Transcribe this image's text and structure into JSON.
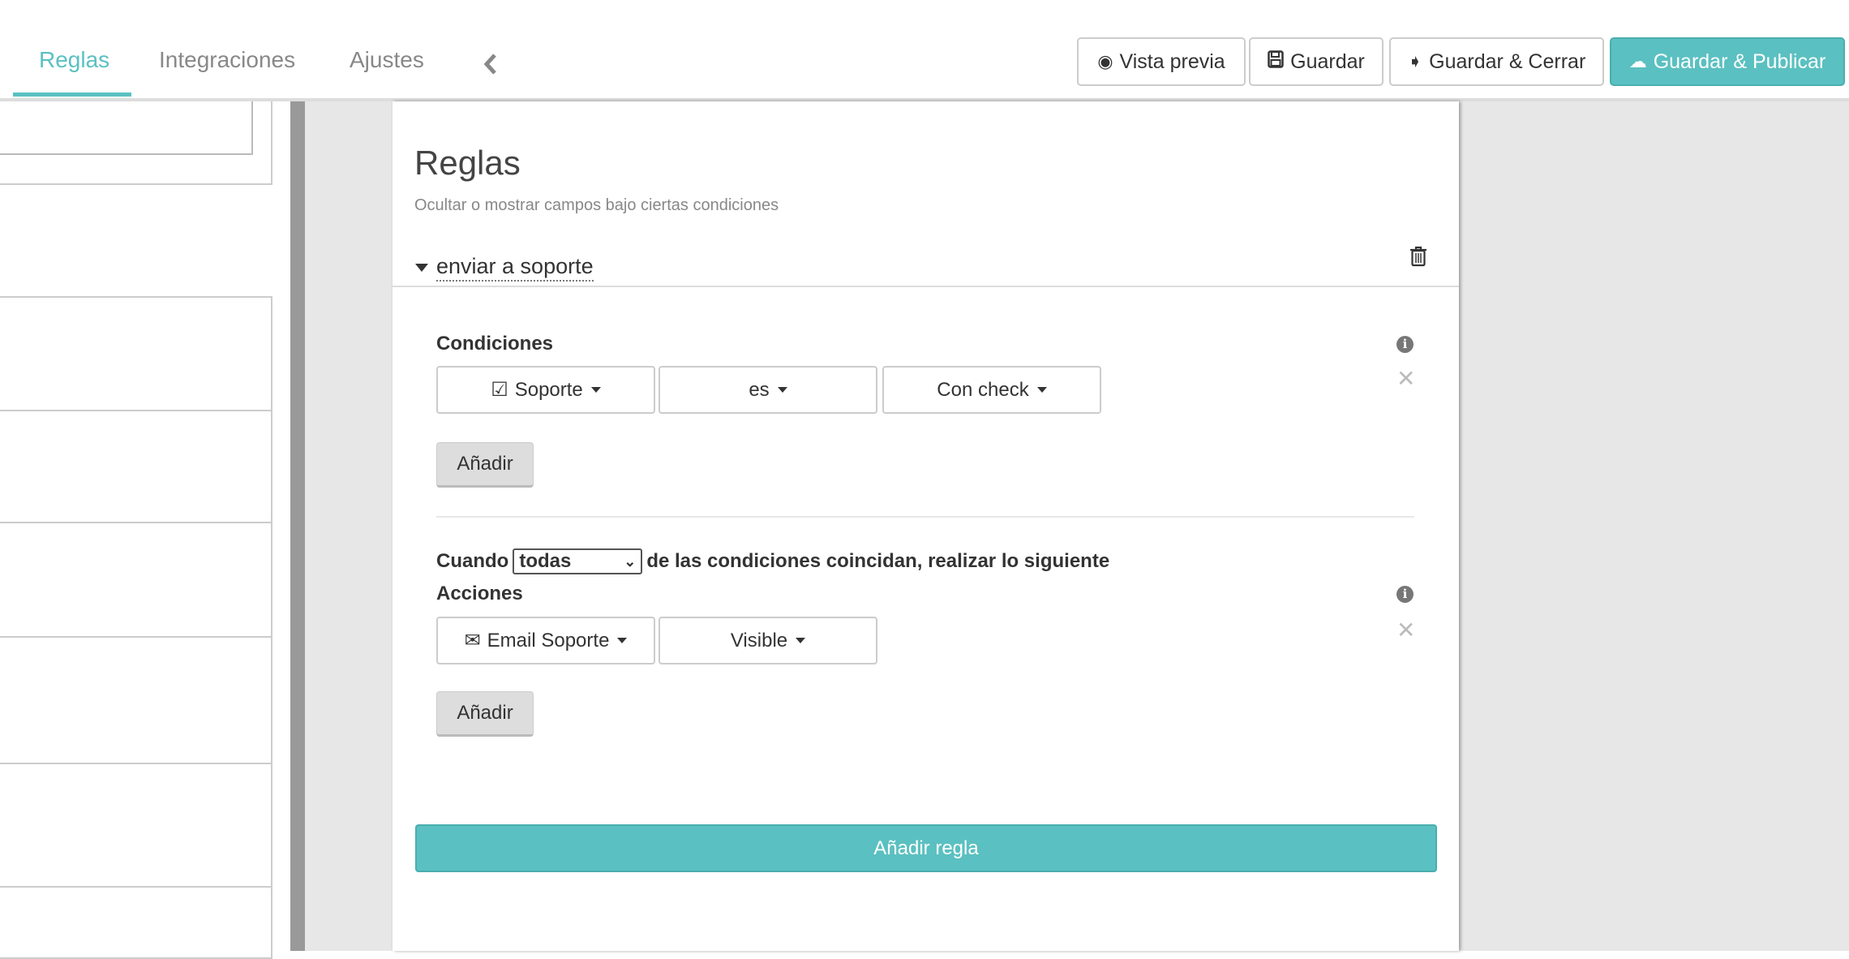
{
  "tabs": [
    {
      "label": "Reglas",
      "active": true
    },
    {
      "label": "Integraciones"
    },
    {
      "label": "Ajustes"
    }
  ],
  "collapse_icon": "chevron-left-icon",
  "toolbar": {
    "preview": "Vista previa",
    "save": "Guardar",
    "save_close": "Guardar & Cerrar",
    "save_publish": "Guardar & Publicar"
  },
  "colors": {
    "accent": "#5bc0c1"
  },
  "panel": {
    "title": "Reglas",
    "subtitle": "Ocultar o mostrar campos bajo ciertas condiciones",
    "rule": {
      "name": "enviar a soporte",
      "conditions_label": "Condiciones",
      "condition": {
        "field": "Soporte",
        "operator": "es",
        "value": "Con check"
      },
      "add_label": "Añadir",
      "when_prefix": "Cuando",
      "match_select": "todas",
      "when_suffix": "de las condiciones coincidan, realizar lo siguiente",
      "actions_label": "Acciones",
      "action": {
        "field": "Email Soporte",
        "value": "Visible"
      }
    },
    "add_rule": "Añadir regla"
  }
}
